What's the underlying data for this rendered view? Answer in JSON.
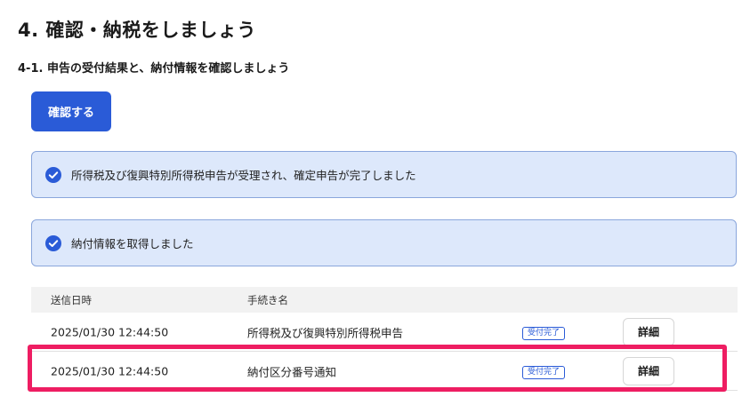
{
  "heading": "4. 確認・納税をしましょう",
  "subheading": "4-1. 申告の受付結果と、納付情報を確認しましょう",
  "confirm_button": "確認する",
  "notices": [
    {
      "text": "所得税及び復興特別所得税申告が受理され、確定申告が完了しました",
      "icon": "check-circle-icon"
    },
    {
      "text": "納付情報を取得しました",
      "icon": "check-circle-icon"
    }
  ],
  "table": {
    "headers": {
      "date": "送信日時",
      "procedure": "手続き名"
    },
    "rows": [
      {
        "date": "2025/01/30 12:44:50",
        "procedure": "所得税及び復興特別所得税申告",
        "status": "受付完了",
        "action": "詳細"
      },
      {
        "date": "2025/01/30 12:44:50",
        "procedure": "納付区分番号通知",
        "status": "受付完了",
        "action": "詳細"
      }
    ]
  },
  "colors": {
    "accent": "#2a5bd7",
    "notice_bg": "#dde8fb",
    "highlight": "#ee1d62"
  }
}
